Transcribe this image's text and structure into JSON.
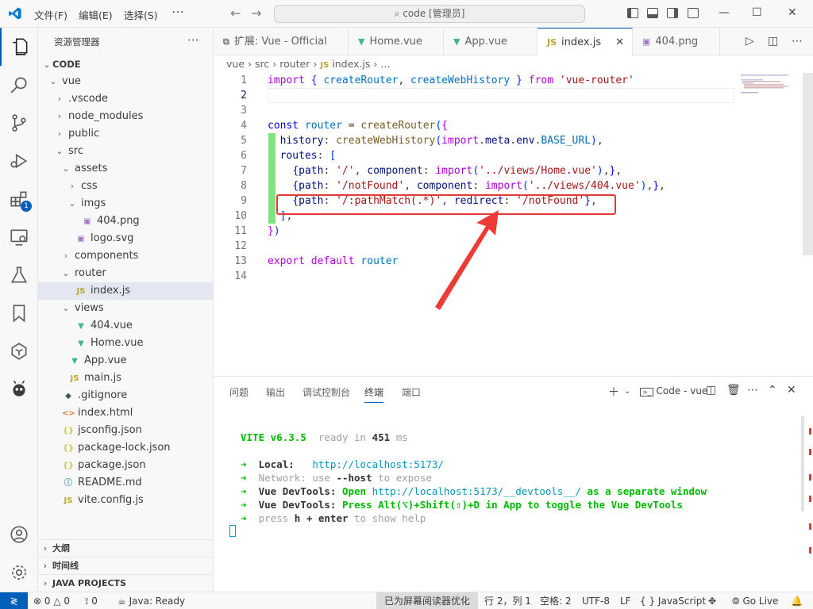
{
  "titlebar": {
    "menus": [
      "文件(F)",
      "编辑(E)",
      "选择(S)"
    ],
    "command_center": "code [管理员]"
  },
  "activity": {
    "extensions_badge": "1"
  },
  "sidebar": {
    "title": "资源管理器",
    "root": "CODE",
    "tree": [
      {
        "label": "vue",
        "icon": "",
        "chev": "⌄",
        "indent": 1
      },
      {
        "label": ".vscode",
        "icon": "",
        "chev": "›",
        "indent": 2
      },
      {
        "label": "node_modules",
        "icon": "",
        "chev": "›",
        "indent": 2
      },
      {
        "label": "public",
        "icon": "",
        "chev": "›",
        "indent": 2
      },
      {
        "label": "src",
        "icon": "",
        "chev": "⌄",
        "indent": 2
      },
      {
        "label": "assets",
        "icon": "",
        "chev": "⌄",
        "indent": 3
      },
      {
        "label": "css",
        "icon": "",
        "chev": "›",
        "indent": 4
      },
      {
        "label": "imgs",
        "icon": "",
        "chev": "⌄",
        "indent": 4
      },
      {
        "label": "404.png",
        "icon": "img",
        "chev": "",
        "indent": 5
      },
      {
        "label": "logo.svg",
        "icon": "img",
        "chev": "",
        "indent": 4
      },
      {
        "label": "components",
        "icon": "",
        "chev": "›",
        "indent": 3
      },
      {
        "label": "router",
        "icon": "",
        "chev": "⌄",
        "indent": 3
      },
      {
        "label": "index.js",
        "icon": "js",
        "chev": "",
        "indent": 4
      },
      {
        "label": "views",
        "icon": "",
        "chev": "⌄",
        "indent": 3
      },
      {
        "label": "404.vue",
        "icon": "vue",
        "chev": "",
        "indent": 4
      },
      {
        "label": "Home.vue",
        "icon": "vue",
        "chev": "",
        "indent": 4
      },
      {
        "label": "App.vue",
        "icon": "vue",
        "chev": "",
        "indent": 3
      },
      {
        "label": "main.js",
        "icon": "js",
        "chev": "",
        "indent": 3
      },
      {
        "label": ".gitignore",
        "icon": "git",
        "chev": "",
        "indent": 2
      },
      {
        "label": "index.html",
        "icon": "html",
        "chev": "",
        "indent": 2
      },
      {
        "label": "jsconfig.json",
        "icon": "json",
        "chev": "",
        "indent": 2
      },
      {
        "label": "package-lock.json",
        "icon": "json",
        "chev": "",
        "indent": 2
      },
      {
        "label": "package.json",
        "icon": "json",
        "chev": "",
        "indent": 2
      },
      {
        "label": "README.md",
        "icon": "info",
        "chev": "",
        "indent": 2
      },
      {
        "label": "vite.config.js",
        "icon": "js",
        "chev": "",
        "indent": 2
      }
    ],
    "selected_index": 12,
    "sections": [
      "大纲",
      "时间线",
      "JAVA PROJECTS"
    ]
  },
  "tabs": [
    {
      "label": "扩展: Vue - Official",
      "icon": "ext"
    },
    {
      "label": "Home.vue",
      "icon": "vue"
    },
    {
      "label": "App.vue",
      "icon": "vue"
    },
    {
      "label": "index.js",
      "icon": "js",
      "active": true
    },
    {
      "label": "404.png",
      "icon": "img"
    }
  ],
  "breadcrumb": [
    "vue",
    "src",
    "router",
    "index.js",
    "..."
  ],
  "editor": {
    "current_line": 2,
    "line_numbers": [
      "1",
      "2",
      "3",
      "4",
      "5",
      "6",
      "7",
      "8",
      "9",
      "10",
      "11",
      "12",
      "13",
      "14"
    ]
  },
  "panel": {
    "tabs": [
      "问题",
      "输出",
      "调试控制台",
      "终端",
      "端口"
    ],
    "active_tab": "终端",
    "terminal_name": "Code - vue",
    "terminal": {
      "vite_name": "VITE",
      "vite_version": "v6.3.5",
      "ready_text": "ready in",
      "ready_ms": "451",
      "ready_unit": "ms",
      "local_label": "Local:",
      "local_url": "http://localhost:5173/",
      "network_label": "Network:",
      "network_text_1": "use",
      "network_flag": "--host",
      "network_text_2": "to expose",
      "devtools_label": "Vue DevTools:",
      "devtools_line1_a": "Open",
      "devtools_line1_url": "http://localhost:5173/__devtools__/",
      "devtools_line1_b": "as a separate window",
      "devtools_line2": "Press Alt(⌥)+Shift(⇧)+D in App to toggle the Vue DevTools",
      "help_a": "press",
      "help_key": "h + enter",
      "help_b": "to show help"
    }
  },
  "status": {
    "errors": "0",
    "warnings": "0",
    "ports": "0",
    "java": "Java: Ready",
    "screen_reader": "已为屏幕阅读器优化",
    "position": "行 2，列 1",
    "spaces": "空格: 2",
    "encoding": "UTF-8",
    "eol": "LF",
    "language": "JavaScript",
    "golive": "Go Live"
  },
  "colors": {
    "accent": "#005fb8",
    "annotation": "#e53935",
    "vue": "#41b883",
    "diff_added": "#81e281"
  }
}
